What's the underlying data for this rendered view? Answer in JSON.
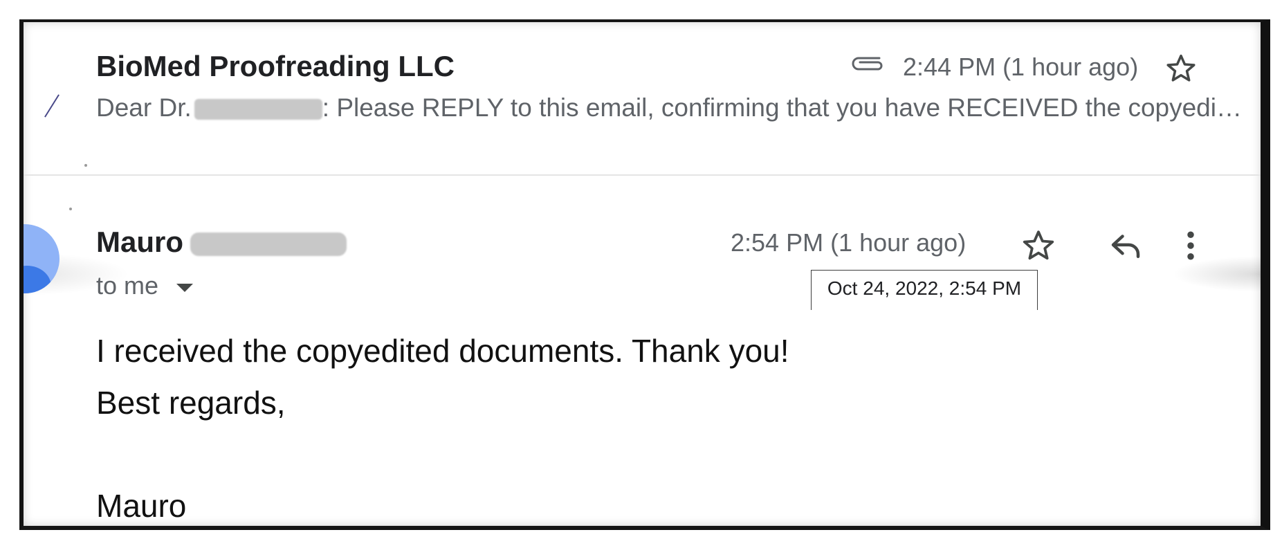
{
  "thread": {
    "collapsed_message": {
      "sender": "BioMed Proofreading LLC",
      "time": "2:44 PM (1 hour ago)",
      "snippet_prefix": "Dear Dr.",
      "snippet_rest": ": Please REPLY to this email, confirming that you have RECEIVED the copyedited documents. If you have any questions, please contact us.",
      "has_attachment": true,
      "starred": false
    },
    "open_message": {
      "sender_first_name": "Mauro",
      "time": "2:54 PM (1 hour ago)",
      "time_tooltip": "Oct 24, 2022, 2:54 PM",
      "recipient": "to me",
      "starred": false,
      "body": {
        "line1": "I received the copyedited documents. Thank you!",
        "line2": "Best regards,",
        "signature": "Mauro"
      }
    }
  },
  "icons": {
    "attachment": "paperclip-icon",
    "star": "star-outline-icon",
    "reply": "reply-icon",
    "more": "more-vert-icon",
    "recipient_toggle": "caret-down-icon"
  },
  "colors": {
    "primary_text": "#202124",
    "secondary_text": "#5f6368",
    "avatar_light": "#8fb3f7",
    "avatar_dark": "#3c79e6",
    "frame": "#161616"
  }
}
